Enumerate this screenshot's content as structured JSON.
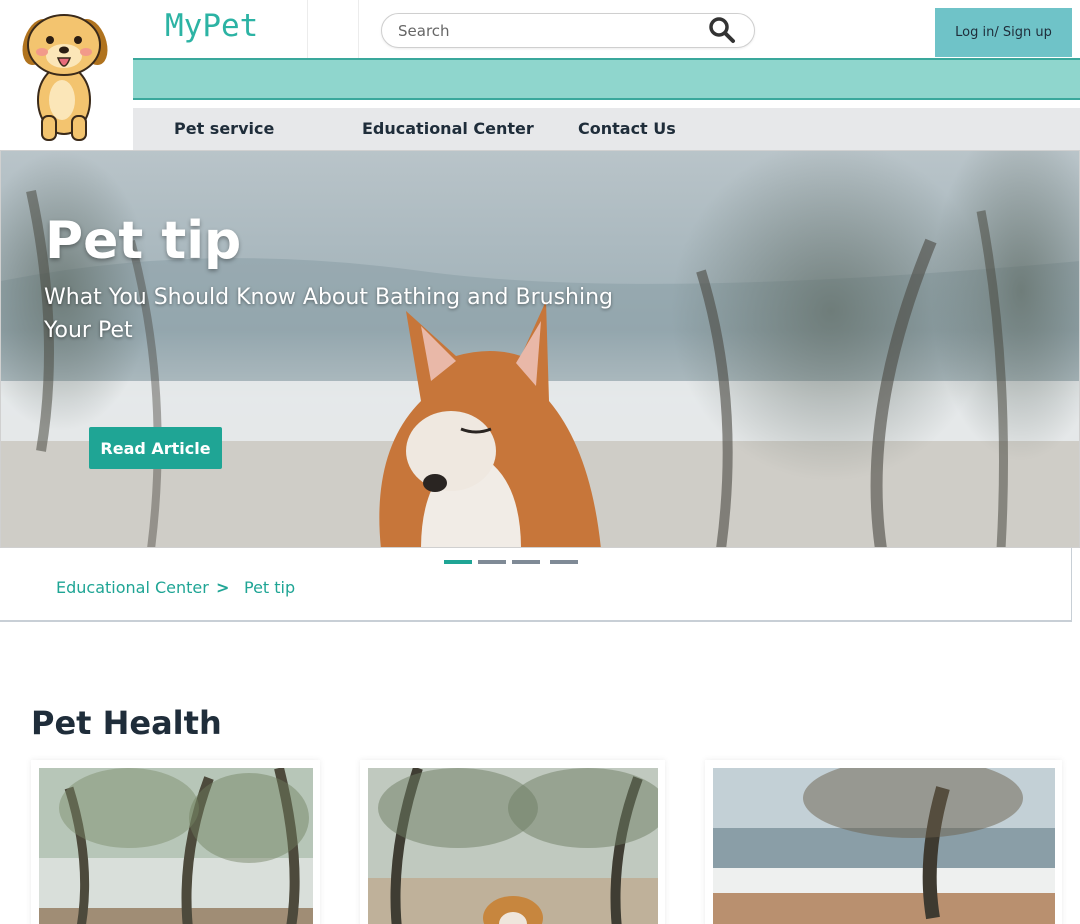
{
  "header": {
    "brand": "MyPet",
    "search_placeholder": "Search",
    "login_label": "Log in/ Sign up"
  },
  "nav": {
    "items": [
      "Pet service",
      "Educational Center",
      "Contact Us"
    ]
  },
  "hero": {
    "title": "Pet tip",
    "subtitle": "What You Should Know About Bathing and Brushing Your Pet",
    "button_label": "Read Article",
    "slides_total": 4,
    "active_slide": 1
  },
  "breadcrumb": {
    "parent": "Educational Center",
    "separator": ">",
    "current": "Pet tip"
  },
  "section": {
    "title": "Pet Health"
  },
  "colors": {
    "accent": "#1fa595",
    "teal_bar": "#8fd6cd",
    "login_bg": "#6fc3c8",
    "nav_bg": "#e7e8ea",
    "text_dark": "#1f2d3a"
  },
  "icons": {
    "logo": "puppy-mascot-icon",
    "search": "search-icon"
  }
}
